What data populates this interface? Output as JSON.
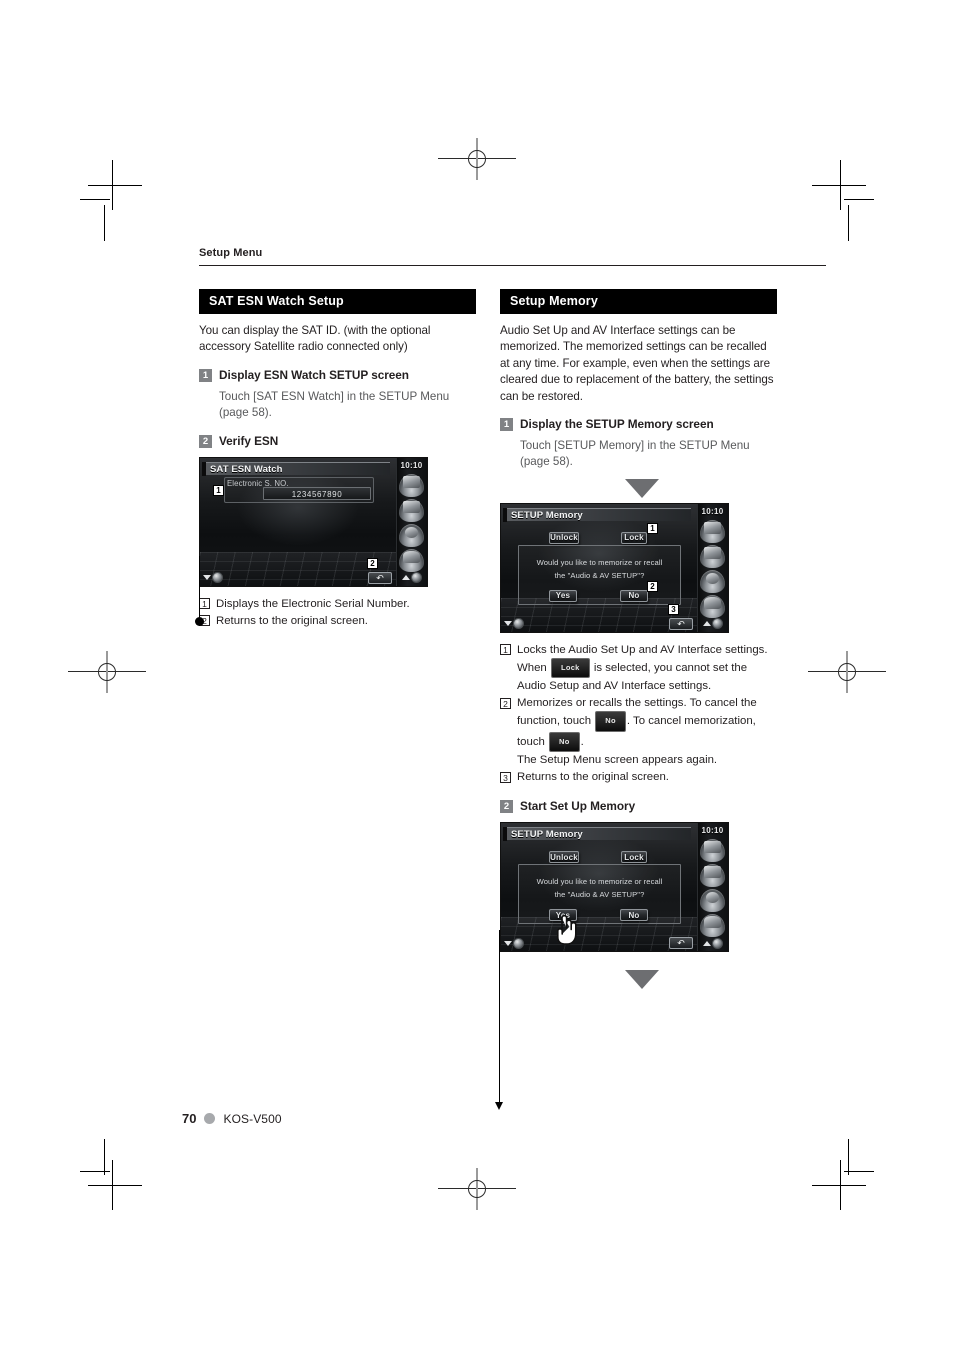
{
  "page": {
    "running_head": "Setup Menu",
    "page_number": "70",
    "model": "KOS-V500"
  },
  "left_column": {
    "section_title": "SAT ESN Watch Setup",
    "intro": "You can display the SAT ID. (with the optional accessory Satellite radio connected only)",
    "steps": [
      {
        "num": "1",
        "title": "Display ESN Watch SETUP screen",
        "body": "Touch [SAT ESN Watch] in the SETUP Menu (page 58)."
      },
      {
        "num": "2",
        "title": "Verify ESN",
        "body": ""
      }
    ],
    "screenshot": {
      "title": "SAT ESN Watch",
      "clock": "10:10",
      "field_label": "Electronic S. NO.",
      "field_value": "1234567890",
      "tag_1": "1",
      "tag_2": "2"
    },
    "callouts": [
      {
        "num": "1",
        "text": "Displays the Electronic Serial Number."
      },
      {
        "num": "2",
        "text": "Returns to the original screen."
      }
    ]
  },
  "right_column": {
    "section_title": "Setup Memory",
    "intro": "Audio Set Up and AV Interface settings can be memorized. The memorized settings can be recalled at any time. For example, even when the settings are cleared due to replacement of the battery, the settings can be restored.",
    "steps": [
      {
        "num": "1",
        "title": "Display the SETUP Memory screen",
        "body": "Touch [SETUP Memory] in the SETUP Menu (page 58)."
      },
      {
        "num": "2",
        "title": "Start Set Up Memory",
        "body": ""
      }
    ],
    "screenshot_1": {
      "title": "SETUP Memory",
      "clock": "10:10",
      "unlock_label": "Unlock",
      "lock_label": "Lock",
      "dialog_line_1": "Would you like to memorize or recall",
      "dialog_line_2": "the \"Audio & AV SETUP\"?",
      "yes_label": "Yes",
      "no_label": "No",
      "tag_1": "1",
      "tag_2": "2",
      "tag_3": "3"
    },
    "screenshot_2": {
      "title": "SETUP Memory",
      "clock": "10:10",
      "unlock_label": "Unlock",
      "lock_label": "Lock",
      "dialog_line_1": "Would you like to memorize or recall",
      "dialog_line_2": "the \"Audio & AV SETUP\"?",
      "yes_label": "Yes",
      "no_label": "No"
    },
    "callouts": [
      {
        "num": "1",
        "part_a": "Locks the Audio Set Up and AV Interface settings. When",
        "btn": "Lock",
        "part_b": "is selected, you cannot set the Audio Setup and AV Interface settings."
      },
      {
        "num": "2",
        "part_a": "Memorizes or recalls the settings. To cancel the function, touch",
        "btn_1": "No",
        "part_b": ". To cancel memorization, touch",
        "btn_2": "No",
        "part_c": ".",
        "part_d": "The Setup Menu screen appears again."
      },
      {
        "num": "3",
        "text": "Returns to the original screen."
      }
    ]
  }
}
